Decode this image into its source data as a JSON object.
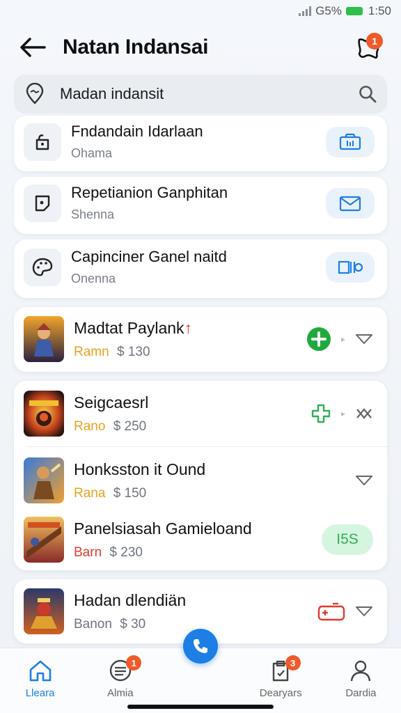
{
  "status_bar": {
    "network": "G5%",
    "time": "1:50"
  },
  "header": {
    "title": "Natan Indansai",
    "notification_count": "1"
  },
  "search": {
    "value": "Madan indansit"
  },
  "list_items": [
    {
      "title": "Fndandain Idarlaan",
      "subtitle": "Ohama",
      "icon": "lock-icon",
      "action_icon": "camera-icon"
    },
    {
      "title": "Repetianion Ganphitan",
      "subtitle": "Shenna",
      "icon": "square-pin-icon",
      "action_icon": "mail-icon"
    },
    {
      "title": "Capinciner Ganel naitd",
      "subtitle": "Onenna",
      "icon": "palette-icon",
      "action_icon": "media-icon"
    }
  ],
  "games": [
    {
      "title": "Madtat Paylank",
      "title_mark": "↑",
      "label": "Ramn",
      "price": "$ 130"
    },
    {
      "title": "Seigcaesrl",
      "label": "Rano",
      "price": "$ 250"
    },
    {
      "title": "Honksston it Ound",
      "label": "Rana",
      "price": "$ 150"
    },
    {
      "title": "Panelsiasah Gamieloand",
      "label": "Barn",
      "price": "$ 230",
      "action_label": "I5S"
    },
    {
      "title": "Hadan dlendiän",
      "label": "Banon",
      "price": "$ 30"
    }
  ],
  "colors": {
    "accent": "#1d7ee6",
    "badge": "#f05a2a",
    "green": "#2fae57",
    "gold": "#e8a21a",
    "red": "#e03a2f"
  },
  "tabbar": {
    "tabs": [
      {
        "label": "Lleara",
        "icon": "home-icon",
        "active": true
      },
      {
        "label": "Almia",
        "icon": "coin-icon",
        "badge": "1"
      },
      {
        "label": "",
        "icon": "phone-icon"
      },
      {
        "label": "Dearyars",
        "icon": "clipboard-icon",
        "badge": "3"
      },
      {
        "label": "Dardia",
        "icon": "user-icon"
      }
    ]
  }
}
